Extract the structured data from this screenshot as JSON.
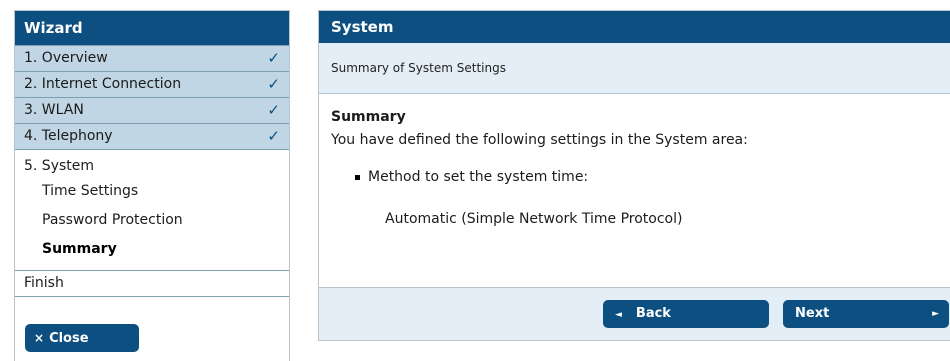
{
  "sidebar": {
    "title": "Wizard",
    "completed_steps": [
      {
        "label": "1. Overview",
        "check": "✓"
      },
      {
        "label": "2. Internet Connection",
        "check": "✓"
      },
      {
        "label": "3. WLAN",
        "check": "✓"
      },
      {
        "label": "4. Telephony",
        "check": "✓"
      }
    ],
    "current_step": {
      "label": "5. System",
      "sub_items": [
        "Time Settings",
        "Password Protection",
        "Summary"
      ],
      "active_sub_item": "Summary"
    },
    "finish_label": "Finish",
    "close_label": "Close",
    "close_icon": "×"
  },
  "panel": {
    "title": "System",
    "subtitle": "Summary of System Settings",
    "summary_heading": "Summary",
    "summary_intro": "You have defined the following settings in the System area:",
    "setting_label": "Method to set the system time:",
    "setting_value": "Automatic (Simple Network Time Protocol)"
  },
  "footer": {
    "back_label": "Back",
    "next_label": "Next",
    "back_icon": "◄",
    "next_icon": "►"
  },
  "colors": {
    "brand": "#0c4f80",
    "completed_step_bg": "#c0d6e4",
    "panel_tint": "#e3eef6"
  }
}
